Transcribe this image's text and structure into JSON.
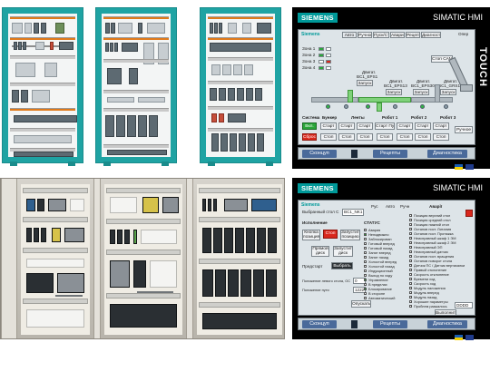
{
  "hmi_top": {
    "brand": "SIEMENS",
    "model": "SIMATIC HMI",
    "side_text": "TOUCH",
    "logo_text": "Siemens",
    "tabs": [
      "Авто",
      "Ручной",
      "Пуск/Стоп",
      "Аварии",
      "Рецепты",
      "Диагностика"
    ],
    "stop_all": "Стоп САМ",
    "oper": "Опер",
    "mode_labels": [
      "Система",
      "Бункер",
      "Ленты",
      "Робот 1",
      "Робот 2",
      "Робот 3"
    ],
    "zones": [
      "Зона 1",
      "Зона 2",
      "Зона 3",
      "Зона 4"
    ],
    "drives": [
      {
        "label": "Двигат.",
        "code": "BC1_EPS1"
      },
      {
        "label": "Двигат.",
        "code": "BC1_EPS13"
      },
      {
        "label": "Двигат.",
        "code": "BC1_EPS30"
      },
      {
        "label": "Двигат.",
        "code": "BC1_GRS1"
      }
    ],
    "zapusk": [
      "Запуск",
      "Запуск",
      "Запуск",
      "Запуск"
    ],
    "row_start": [
      "Старт",
      "Старт",
      "Старт",
      "Старт Пуск",
      "Старт",
      "Старт",
      "Старт"
    ],
    "row_stop": [
      "Стоп",
      "Стоп",
      "Стоп",
      "Стоп",
      "Стоп",
      "Стоп",
      "Стоп"
    ],
    "run_btn": "Вкл.",
    "reset_btn": "Сброс",
    "manual": "Ручное",
    "taskbar": {
      "btn1": "Сконцуп",
      "btn2": "Рецепты",
      "btn3": "Диагностика"
    }
  },
  "hmi_bottom": {
    "brand": "SIEMENS",
    "model": "SIMATIC HMI",
    "logo_text": "Siemens",
    "selector_label": "Выбранный стол С",
    "selector_value": "BC1_NK1",
    "mode_tabs": [
      "Рус",
      "Авто",
      "Ручн"
    ],
    "group_title": "Исполнение",
    "status_title": "СТАТУС",
    "alarms_title": "Аварії",
    "buttons": [
      "Кнопка позиция",
      "Стоп",
      "Запустить позицию",
      "Прямой диск",
      "Запустить диск"
    ],
    "prestart_label": "Предстарт",
    "prestart_btn": "Выбрать",
    "status_items": [
      "Авария",
      "Неподвижно",
      "Заблокирован",
      "Готовый вперед",
      "Готовый назад",
      "Занят вперед",
      "Занят назад",
      "Холостой вперед",
      "Холостой назад",
      "Индукционный",
      "Выход по ходу",
      "Управление",
      "В пределах",
      "Блокирование",
      "В стороне",
      "Автоматический"
    ],
    "alarm_items": [
      "Позиция верхний стол",
      "Позиция средний стол",
      "Позиция нижний стол",
      "Останов пост. Литания",
      "Останов пост. Протяжка",
      "Неисправный шкаф 1 ЭМ",
      "Неисправный шкаф 2 ЭМ",
      "Неисправный ЭП",
      "Неисправный датчик",
      "Останов пост. вращения",
      "Останов поворот стола",
      "Датчик ПС / Датчик вертикалки",
      "Правый отклонение",
      "Скорость отклонение",
      "Времени ход",
      "Скорость ход",
      "Модуль наложения",
      "Модуль вперед",
      "Модуль назад",
      "Хорошие параметры",
      "Проблем разжалось"
    ],
    "fields": [
      {
        "label": "Положение левого стола, ОС",
        "value": "0"
      },
      {
        "label": "Положение пути",
        "value": "1222"
      }
    ],
    "confirm_btn": "Опускать",
    "apply_btn": "Выполнить",
    "timestamp": "DDDD",
    "taskbar": {
      "btn1": "Сконцуп",
      "btn2": "Рецепты",
      "btn3": "Диагностика"
    }
  },
  "colors": {
    "siemens_teal": "#009999",
    "cad_frame": "#1fa3a3",
    "hmi_bezel": "#000000",
    "alarm_red": "#d9271c",
    "ok_green": "#2aa63a"
  }
}
